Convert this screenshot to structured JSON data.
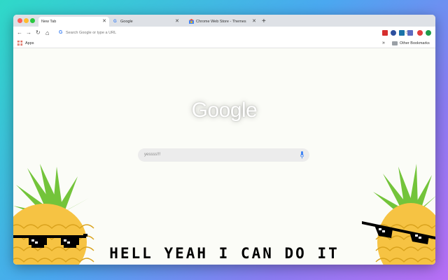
{
  "tabs": [
    {
      "label": "New Tab",
      "active": true
    },
    {
      "label": "Google",
      "active": false
    },
    {
      "label": "Chrome Web Store - Themes",
      "active": false
    }
  ],
  "toolbar": {
    "back_icon": "←",
    "forward_icon": "→",
    "reload_icon": "↻",
    "home_icon": "⌂",
    "omnibox_placeholder": "Search Google or type a URL",
    "star_icon": "☆"
  },
  "bookmarks": {
    "apps_label": "Apps",
    "other_bookmarks_label": "Other Bookmarks",
    "more_icon": "»"
  },
  "newtab": {
    "logo_text": "Google",
    "search_value": "yessss!!!",
    "slogan": "HELL YEAH I CAN DO IT"
  },
  "colors": {
    "accent_blue": "#4285f4",
    "pineapple_yellow": "#f6c343",
    "leaf_green": "#73c43a"
  }
}
